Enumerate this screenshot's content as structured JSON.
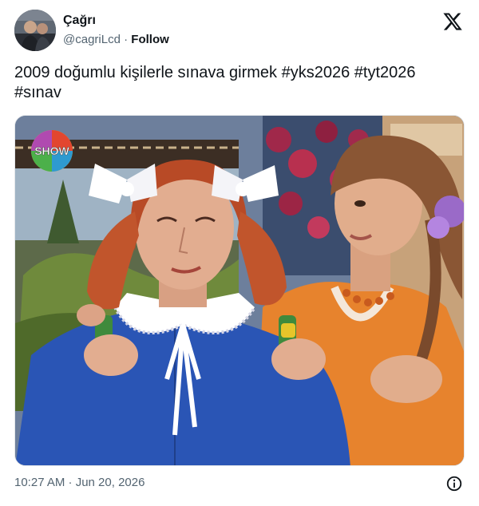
{
  "user": {
    "display_name": "Çağrı",
    "handle": "@cagriLcd",
    "separator": "·",
    "follow_label": "Follow"
  },
  "tweet": {
    "text_prefix": "2009 doğumlu kişilerle sınava girmek ",
    "hashtags": [
      "#yks2026",
      "#tyt2026",
      "#sınav"
    ]
  },
  "media": {
    "channel_logo_text": "SHOW"
  },
  "footer": {
    "timestamp": "10:27 AM · Jun 20, 2026"
  },
  "icons": {
    "brand": "x-logo-icon",
    "info": "info-icon"
  },
  "colors": {
    "text": "#0f1419",
    "secondary_text": "#536471",
    "background": "#ffffff"
  }
}
